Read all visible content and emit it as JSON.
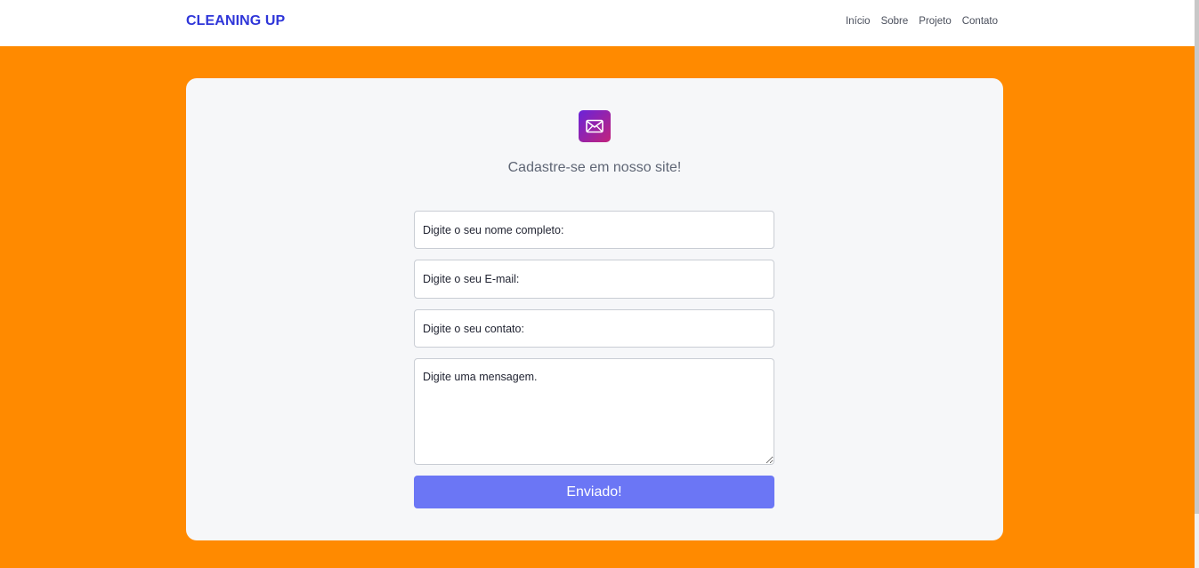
{
  "navbar": {
    "brand": "CLEANING UP",
    "links": [
      {
        "label": "Início"
      },
      {
        "label": "Sobre"
      },
      {
        "label": "Projeto"
      },
      {
        "label": "Contato"
      }
    ]
  },
  "form": {
    "icon": "mail-icon",
    "title": "Cadastre-se em nosso site!",
    "name_placeholder": "Digite o seu nome completo:",
    "email_placeholder": "Digite o seu E-mail:",
    "contact_placeholder": "Digite o seu contato:",
    "message_placeholder": "Digite uma mensagem.",
    "submit_label": "Enviado!"
  },
  "colors": {
    "background": "#ff8a00",
    "brand": "#2f36d9",
    "button": "#6b76f5",
    "icon_gradient_start": "#6a23d9",
    "icon_gradient_end": "#c2237b"
  }
}
